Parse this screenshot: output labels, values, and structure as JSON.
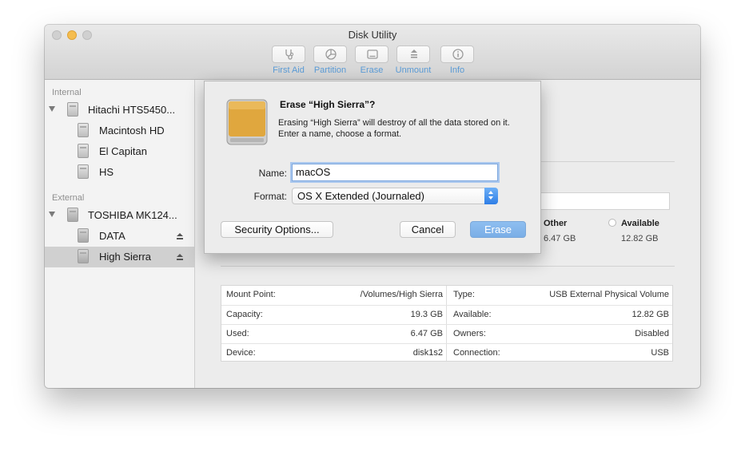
{
  "window": {
    "title": "Disk Utility"
  },
  "toolbar": {
    "items": [
      {
        "label": "First Aid",
        "icon": "stethoscope-icon"
      },
      {
        "label": "Partition",
        "icon": "pie-icon"
      },
      {
        "label": "Erase",
        "icon": "erase-icon"
      },
      {
        "label": "Unmount",
        "icon": "unmount-icon"
      },
      {
        "label": "Info",
        "icon": "info-icon"
      }
    ]
  },
  "sidebar": {
    "internal_header": "Internal",
    "external_header": "External",
    "internal": [
      {
        "label": "Hitachi HTS5450...",
        "level": 0
      },
      {
        "label": "Macintosh HD",
        "level": 1
      },
      {
        "label": "El Capitan",
        "level": 1
      },
      {
        "label": "HS",
        "level": 1
      }
    ],
    "external": [
      {
        "label": "TOSHIBA MK124...",
        "level": 0
      },
      {
        "label": "DATA",
        "level": 1
      },
      {
        "label": "High Sierra",
        "level": 1,
        "selected": true
      }
    ]
  },
  "main": {
    "partial_letter": "d",
    "usage": {
      "other_label": "Other",
      "other_value": "6.47 GB",
      "available_label": "Available",
      "available_value": "12.82 GB"
    },
    "info": {
      "left": [
        {
          "label": "Mount Point:",
          "value": "/Volumes/High Sierra"
        },
        {
          "label": "Capacity:",
          "value": "19.3 GB"
        },
        {
          "label": "Used:",
          "value": "6.47 GB"
        },
        {
          "label": "Device:",
          "value": "disk1s2"
        }
      ],
      "right": [
        {
          "label": "Type:",
          "value": "USB External Physical Volume"
        },
        {
          "label": "Available:",
          "value": "12.82 GB"
        },
        {
          "label": "Owners:",
          "value": "Disabled"
        },
        {
          "label": "Connection:",
          "value": "USB"
        }
      ]
    }
  },
  "dialog": {
    "title": "Erase “High Sierra”?",
    "description": "Erasing “High Sierra” will destroy of all the data stored on it. Enter a name, choose a format.",
    "name_label": "Name:",
    "name_value": "macOS",
    "format_label": "Format:",
    "format_value": "OS X Extended (Journaled)",
    "security_button": "Security Options...",
    "cancel_button": "Cancel",
    "erase_button": "Erase"
  },
  "colors": {
    "accent": "#5a9bd6",
    "erase_button": "#7aaee6",
    "disk_orange": "#e0a73e"
  }
}
